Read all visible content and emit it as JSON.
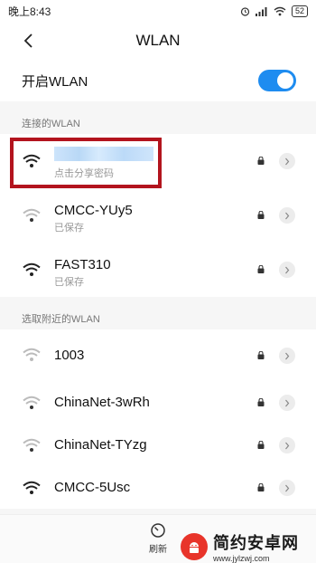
{
  "status_bar": {
    "time": "晚上8:43",
    "battery": "52"
  },
  "header": {
    "title": "WLAN"
  },
  "toggle": {
    "label": "开启WLAN",
    "enabled": true,
    "color": "#1e8cf0"
  },
  "sections": {
    "connected": "连接的WLAN",
    "nearby": "选取附近的WLAN"
  },
  "connected_network": {
    "ssid": "",
    "status": "点击分享密码",
    "highlight_color": "#b3141e"
  },
  "saved_networks": [
    {
      "ssid": "CMCC-YUy5",
      "status": "已保存",
      "signal": "weak"
    },
    {
      "ssid": "FAST310",
      "status": "已保存",
      "signal": "strong"
    }
  ],
  "nearby_networks": [
    {
      "ssid": "1003",
      "signal": "weak"
    },
    {
      "ssid": "ChinaNet-3wRh",
      "signal": "weak"
    },
    {
      "ssid": "ChinaNet-TYzg",
      "signal": "weak"
    },
    {
      "ssid": "CMCC-5Usc",
      "signal": "strong"
    }
  ],
  "bottom": {
    "refresh_label": "刷新"
  },
  "watermark": {
    "title": "简约安卓网",
    "url": "www.jylzwj.com"
  }
}
